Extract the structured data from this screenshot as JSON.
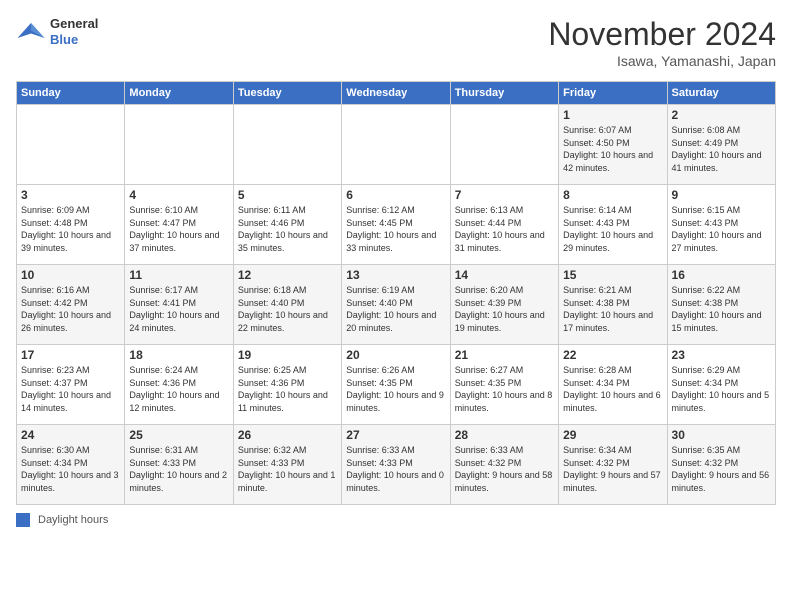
{
  "header": {
    "logo_general": "General",
    "logo_blue": "Blue",
    "title": "November 2024",
    "location": "Isawa, Yamanashi, Japan"
  },
  "days_of_week": [
    "Sunday",
    "Monday",
    "Tuesday",
    "Wednesday",
    "Thursday",
    "Friday",
    "Saturday"
  ],
  "legend": {
    "label": "Daylight hours"
  },
  "weeks": [
    {
      "days": [
        {
          "num": "",
          "info": ""
        },
        {
          "num": "",
          "info": ""
        },
        {
          "num": "",
          "info": ""
        },
        {
          "num": "",
          "info": ""
        },
        {
          "num": "",
          "info": ""
        },
        {
          "num": "1",
          "info": "Sunrise: 6:07 AM\nSunset: 4:50 PM\nDaylight: 10 hours\nand 42 minutes."
        },
        {
          "num": "2",
          "info": "Sunrise: 6:08 AM\nSunset: 4:49 PM\nDaylight: 10 hours\nand 41 minutes."
        }
      ]
    },
    {
      "days": [
        {
          "num": "3",
          "info": "Sunrise: 6:09 AM\nSunset: 4:48 PM\nDaylight: 10 hours\nand 39 minutes."
        },
        {
          "num": "4",
          "info": "Sunrise: 6:10 AM\nSunset: 4:47 PM\nDaylight: 10 hours\nand 37 minutes."
        },
        {
          "num": "5",
          "info": "Sunrise: 6:11 AM\nSunset: 4:46 PM\nDaylight: 10 hours\nand 35 minutes."
        },
        {
          "num": "6",
          "info": "Sunrise: 6:12 AM\nSunset: 4:45 PM\nDaylight: 10 hours\nand 33 minutes."
        },
        {
          "num": "7",
          "info": "Sunrise: 6:13 AM\nSunset: 4:44 PM\nDaylight: 10 hours\nand 31 minutes."
        },
        {
          "num": "8",
          "info": "Sunrise: 6:14 AM\nSunset: 4:43 PM\nDaylight: 10 hours\nand 29 minutes."
        },
        {
          "num": "9",
          "info": "Sunrise: 6:15 AM\nSunset: 4:43 PM\nDaylight: 10 hours\nand 27 minutes."
        }
      ]
    },
    {
      "days": [
        {
          "num": "10",
          "info": "Sunrise: 6:16 AM\nSunset: 4:42 PM\nDaylight: 10 hours\nand 26 minutes."
        },
        {
          "num": "11",
          "info": "Sunrise: 6:17 AM\nSunset: 4:41 PM\nDaylight: 10 hours\nand 24 minutes."
        },
        {
          "num": "12",
          "info": "Sunrise: 6:18 AM\nSunset: 4:40 PM\nDaylight: 10 hours\nand 22 minutes."
        },
        {
          "num": "13",
          "info": "Sunrise: 6:19 AM\nSunset: 4:40 PM\nDaylight: 10 hours\nand 20 minutes."
        },
        {
          "num": "14",
          "info": "Sunrise: 6:20 AM\nSunset: 4:39 PM\nDaylight: 10 hours\nand 19 minutes."
        },
        {
          "num": "15",
          "info": "Sunrise: 6:21 AM\nSunset: 4:38 PM\nDaylight: 10 hours\nand 17 minutes."
        },
        {
          "num": "16",
          "info": "Sunrise: 6:22 AM\nSunset: 4:38 PM\nDaylight: 10 hours\nand 15 minutes."
        }
      ]
    },
    {
      "days": [
        {
          "num": "17",
          "info": "Sunrise: 6:23 AM\nSunset: 4:37 PM\nDaylight: 10 hours\nand 14 minutes."
        },
        {
          "num": "18",
          "info": "Sunrise: 6:24 AM\nSunset: 4:36 PM\nDaylight: 10 hours\nand 12 minutes."
        },
        {
          "num": "19",
          "info": "Sunrise: 6:25 AM\nSunset: 4:36 PM\nDaylight: 10 hours\nand 11 minutes."
        },
        {
          "num": "20",
          "info": "Sunrise: 6:26 AM\nSunset: 4:35 PM\nDaylight: 10 hours\nand 9 minutes."
        },
        {
          "num": "21",
          "info": "Sunrise: 6:27 AM\nSunset: 4:35 PM\nDaylight: 10 hours\nand 8 minutes."
        },
        {
          "num": "22",
          "info": "Sunrise: 6:28 AM\nSunset: 4:34 PM\nDaylight: 10 hours\nand 6 minutes."
        },
        {
          "num": "23",
          "info": "Sunrise: 6:29 AM\nSunset: 4:34 PM\nDaylight: 10 hours\nand 5 minutes."
        }
      ]
    },
    {
      "days": [
        {
          "num": "24",
          "info": "Sunrise: 6:30 AM\nSunset: 4:34 PM\nDaylight: 10 hours\nand 3 minutes."
        },
        {
          "num": "25",
          "info": "Sunrise: 6:31 AM\nSunset: 4:33 PM\nDaylight: 10 hours\nand 2 minutes."
        },
        {
          "num": "26",
          "info": "Sunrise: 6:32 AM\nSunset: 4:33 PM\nDaylight: 10 hours\nand 1 minute."
        },
        {
          "num": "27",
          "info": "Sunrise: 6:33 AM\nSunset: 4:33 PM\nDaylight: 10 hours\nand 0 minutes."
        },
        {
          "num": "28",
          "info": "Sunrise: 6:33 AM\nSunset: 4:32 PM\nDaylight: 9 hours\nand 58 minutes."
        },
        {
          "num": "29",
          "info": "Sunrise: 6:34 AM\nSunset: 4:32 PM\nDaylight: 9 hours\nand 57 minutes."
        },
        {
          "num": "30",
          "info": "Sunrise: 6:35 AM\nSunset: 4:32 PM\nDaylight: 9 hours\nand 56 minutes."
        }
      ]
    }
  ]
}
